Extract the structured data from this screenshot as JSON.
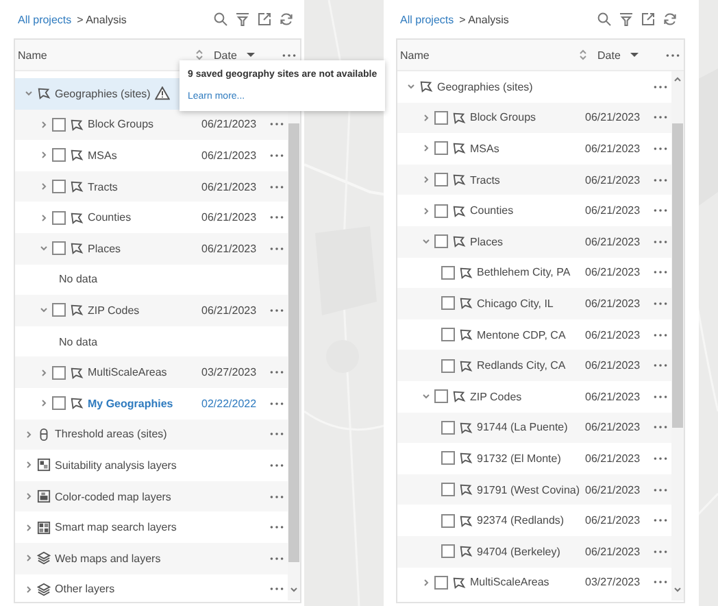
{
  "panels": [
    {
      "breadcrumb": {
        "link": "All projects",
        "current": "> Analysis"
      },
      "columns": [
        {
          "label": "Name",
          "sorted": false
        },
        {
          "label": "Date",
          "sorted": true
        }
      ],
      "tooltip": {
        "message": "9 saved geography sites are not available",
        "link": "Learn more..."
      },
      "rows": [
        {
          "kind": "geography-group",
          "name": "Geographies (sites)",
          "expanded": true,
          "selected": true,
          "warning": true,
          "children": [
            {
              "kind": "geography-layer",
              "name": "Block Groups",
              "date": "06/21/2023",
              "expanded": false,
              "checked": false,
              "selected": false,
              "highlighted": false
            },
            {
              "kind": "geography-layer",
              "name": "MSAs",
              "date": "06/21/2023",
              "expanded": false,
              "checked": false,
              "selected": false,
              "highlighted": false
            },
            {
              "kind": "geography-layer",
              "name": "Tracts",
              "date": "06/21/2023",
              "expanded": false,
              "checked": false,
              "selected": false,
              "highlighted": false
            },
            {
              "kind": "geography-layer",
              "name": "Counties",
              "date": "06/21/2023",
              "expanded": false,
              "checked": false,
              "selected": false,
              "highlighted": false
            },
            {
              "kind": "geography-layer",
              "name": "Places",
              "date": "06/21/2023",
              "expanded": true,
              "checked": false,
              "selected": false,
              "highlighted": false,
              "children": [
                {
                  "kind": "empty-note",
                  "name": "No data"
                }
              ]
            },
            {
              "kind": "geography-layer",
              "name": "ZIP Codes",
              "date": "06/21/2023",
              "expanded": true,
              "checked": false,
              "selected": false,
              "highlighted": false,
              "children": [
                {
                  "kind": "empty-note",
                  "name": "No data"
                }
              ]
            },
            {
              "kind": "geography-layer",
              "name": "MultiScaleAreas",
              "date": "03/27/2023",
              "expanded": false,
              "checked": false,
              "selected": false,
              "highlighted": false
            },
            {
              "kind": "geography-layer",
              "name": "My Geographies",
              "date": "02/22/2022",
              "expanded": false,
              "checked": false,
              "selected": false,
              "highlighted": true
            }
          ]
        },
        {
          "kind": "threshold-group",
          "name": "Threshold areas (sites)",
          "expanded": false,
          "selected": false
        },
        {
          "kind": "suitability-group",
          "name": "Suitability analysis layers",
          "expanded": false,
          "selected": false
        },
        {
          "kind": "color-coded-group",
          "name": "Color-coded map layers",
          "expanded": false,
          "selected": false
        },
        {
          "kind": "smart-search-group",
          "name": "Smart map search layers",
          "expanded": false,
          "selected": false
        },
        {
          "kind": "web-maps-group",
          "name": "Web maps and layers",
          "expanded": false,
          "selected": false
        },
        {
          "kind": "other-layers-group",
          "name": "Other layers",
          "expanded": false,
          "selected": false
        }
      ]
    },
    {
      "breadcrumb": {
        "link": "All projects",
        "current": "> Analysis"
      },
      "columns": [
        {
          "label": "Name",
          "sorted": false
        },
        {
          "label": "Date",
          "sorted": true
        }
      ],
      "rows": [
        {
          "kind": "geography-group",
          "name": "Geographies (sites)",
          "expanded": true,
          "selected": false,
          "warning": false,
          "children": [
            {
              "kind": "geography-layer",
              "name": "Block Groups",
              "date": "06/21/2023",
              "expanded": false,
              "checked": false,
              "selected": false,
              "highlighted": false
            },
            {
              "kind": "geography-layer",
              "name": "MSAs",
              "date": "06/21/2023",
              "expanded": false,
              "checked": false,
              "selected": false,
              "highlighted": false
            },
            {
              "kind": "geography-layer",
              "name": "Tracts",
              "date": "06/21/2023",
              "expanded": false,
              "checked": false,
              "selected": false,
              "highlighted": false
            },
            {
              "kind": "geography-layer",
              "name": "Counties",
              "date": "06/21/2023",
              "expanded": false,
              "checked": false,
              "selected": false,
              "highlighted": false
            },
            {
              "kind": "geography-layer",
              "name": "Places",
              "date": "06/21/2023",
              "expanded": true,
              "checked": false,
              "selected": false,
              "highlighted": false,
              "children": [
                {
                  "kind": "geography-layer",
                  "name": "Bethlehem City, PA",
                  "date": "06/21/2023",
                  "checked": false,
                  "selected": false,
                  "highlighted": false
                },
                {
                  "kind": "geography-layer",
                  "name": "Chicago City, IL",
                  "date": "06/21/2023",
                  "checked": false,
                  "selected": false,
                  "highlighted": false
                },
                {
                  "kind": "geography-layer",
                  "name": "Mentone CDP, CA",
                  "date": "06/21/2023",
                  "checked": false,
                  "selected": false,
                  "highlighted": false
                },
                {
                  "kind": "geography-layer",
                  "name": "Redlands City, CA",
                  "date": "06/21/2023",
                  "checked": false,
                  "selected": false,
                  "highlighted": false
                }
              ]
            },
            {
              "kind": "geography-layer",
              "name": "ZIP Codes",
              "date": "06/21/2023",
              "expanded": true,
              "checked": false,
              "selected": false,
              "highlighted": false,
              "children": [
                {
                  "kind": "geography-layer",
                  "name": "91744 (La Puente)",
                  "date": "06/21/2023",
                  "checked": false,
                  "selected": false,
                  "highlighted": false
                },
                {
                  "kind": "geography-layer",
                  "name": "91732 (El Monte)",
                  "date": "06/21/2023",
                  "checked": false,
                  "selected": false,
                  "highlighted": false
                },
                {
                  "kind": "geography-layer",
                  "name": "91791 (West Covina)",
                  "date": "06/21/2023",
                  "checked": false,
                  "selected": false,
                  "highlighted": false
                },
                {
                  "kind": "geography-layer",
                  "name": "92374 (Redlands)",
                  "date": "06/21/2023",
                  "checked": false,
                  "selected": false,
                  "highlighted": false
                },
                {
                  "kind": "geography-layer",
                  "name": "94704 (Berkeley)",
                  "date": "06/21/2023",
                  "checked": false,
                  "selected": false,
                  "highlighted": false
                }
              ]
            },
            {
              "kind": "geography-layer",
              "name": "MultiScaleAreas",
              "date": "03/27/2023",
              "expanded": false,
              "checked": false,
              "selected": false,
              "highlighted": false
            }
          ]
        }
      ]
    }
  ]
}
